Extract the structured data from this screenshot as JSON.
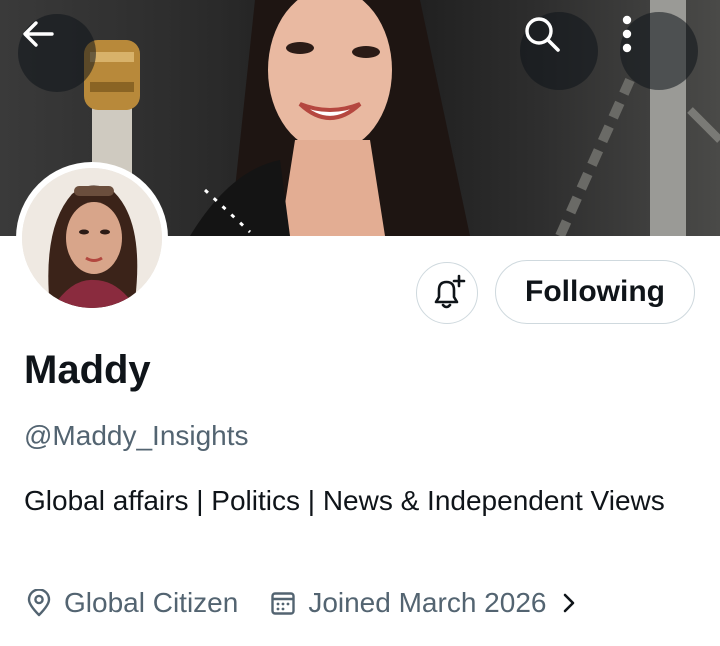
{
  "profile": {
    "name": "Maddy",
    "handle": "@Maddy_Insights",
    "bio": "Global affairs | Politics | News & Independent Views",
    "location": "Global Citizen",
    "joined": "Joined March 2026"
  },
  "actions": {
    "follow_label": "Following"
  },
  "icons": {
    "back": "arrow-left-icon",
    "search": "search-icon",
    "more": "more-vertical-icon",
    "notify": "bell-plus-icon",
    "location": "location-pin-icon",
    "calendar": "calendar-icon",
    "expand": "chevron-right-icon"
  },
  "colors": {
    "text": "#0f1419",
    "secondary": "#536471",
    "border": "#cfd9de"
  }
}
